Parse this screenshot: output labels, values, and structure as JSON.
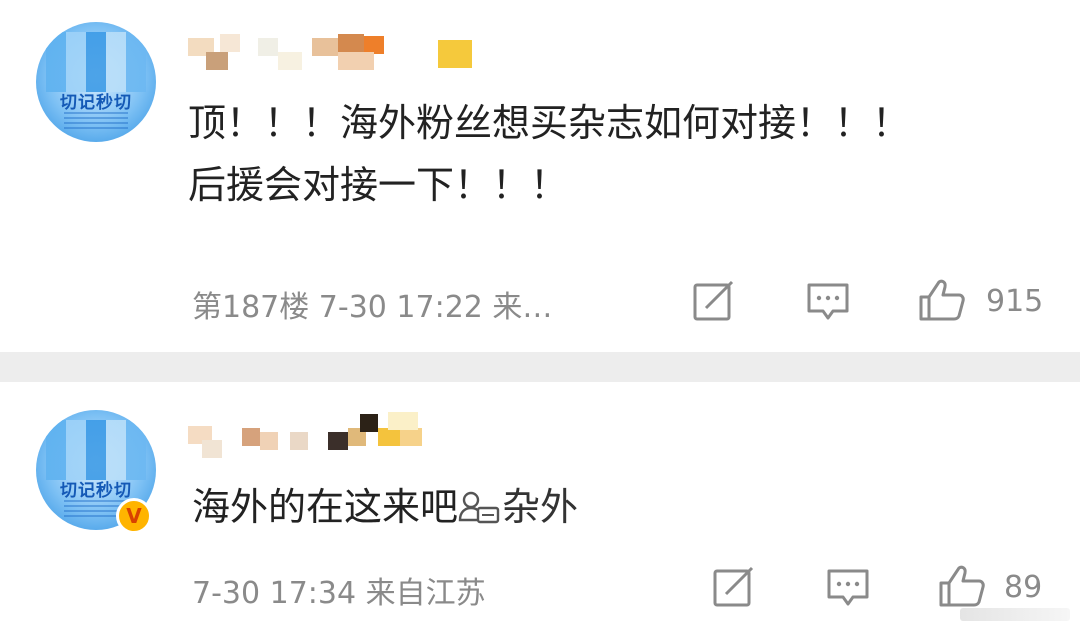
{
  "comments": [
    {
      "avatar_text": "切记秒切",
      "content_lines": [
        "顶！！！海外粉丝想买杂志如何对接！！！",
        "后援会对接一下！！！"
      ],
      "meta": "第187楼 7-30 17:22 来…",
      "like_count": "915",
      "verified": false
    },
    {
      "avatar_text": "切记秒切",
      "content_text": "海外的在这来吧",
      "mention": "杂外",
      "meta": "7-30 17:34 来自江苏",
      "like_count": "89",
      "verified": true,
      "badge": "V"
    }
  ],
  "icons": {
    "reply": "edit-square-icon",
    "comment": "speech-bubble-icon",
    "like": "thumbs-up-icon",
    "mention": "people-group-icon"
  },
  "colors": {
    "text": "#222222",
    "meta": "#8a8a8a",
    "separator": "#ededed",
    "verified_badge": "#ffb400"
  }
}
